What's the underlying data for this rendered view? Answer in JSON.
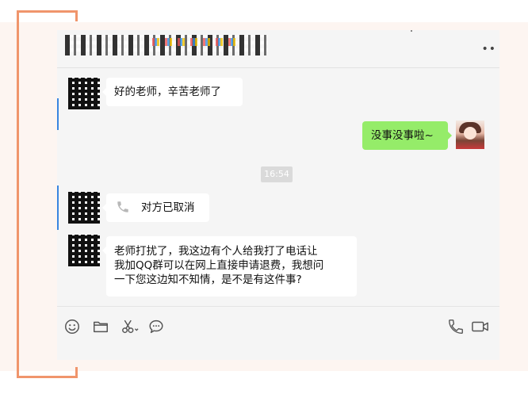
{
  "chat": {
    "messages": [
      {
        "side": "left",
        "type": "text",
        "text": "好的老师，辛苦老师了"
      },
      {
        "side": "right",
        "type": "text",
        "text": "没事没事啦~"
      },
      {
        "type": "time",
        "text": "16:54"
      },
      {
        "side": "left",
        "type": "call",
        "text": "对方已取消",
        "icon": "phone-icon"
      },
      {
        "side": "left",
        "type": "text",
        "lines": [
          "老师打扰了，我这边有个人给我打了电话让",
          "我加QQ群可以在网上直接申请退费，我想问",
          "一下您这边知不知情，是不是有这件事?"
        ]
      }
    ]
  },
  "toolbar": {
    "left_icons": [
      "emoji-icon",
      "folder-icon",
      "scissors-icon",
      "chat-bubble-icon"
    ],
    "right_icons": [
      "phone-icon",
      "video-icon"
    ]
  },
  "colors": {
    "accent_bracket": "#f0956c",
    "self_bubble": "#95ec69",
    "other_bubble": "#ffffff",
    "side_accent": "#3a86e0"
  }
}
